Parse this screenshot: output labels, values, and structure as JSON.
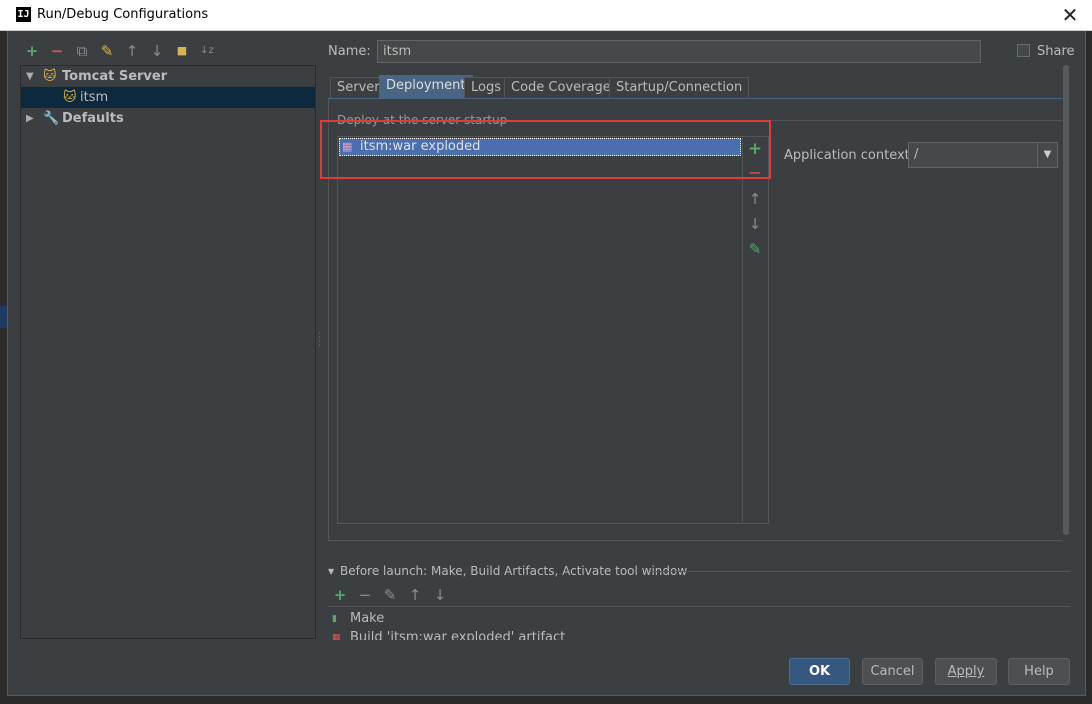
{
  "window": {
    "title": "Run/Debug Configurations",
    "app_icon": "IJ",
    "close_glyph": "✕"
  },
  "toolbar": {
    "add": "+",
    "remove": "−",
    "copy": "⧉",
    "edit_defaults": "✎",
    "move_up": "↑",
    "move_down": "↓",
    "folder": "■",
    "sort": "↓z"
  },
  "tree": {
    "items": [
      {
        "label": "Tomcat Server",
        "expanded": true,
        "icon": "tomcat-icon"
      },
      {
        "label": "itsm",
        "selected": true,
        "icon": "tomcat-icon"
      },
      {
        "label": "Defaults",
        "expanded": false,
        "icon": "wrench-icon"
      }
    ]
  },
  "name_field": {
    "label": "Name:",
    "value": "itsm"
  },
  "share": {
    "label": "Share",
    "checked": false
  },
  "tabs": [
    {
      "label": "Server"
    },
    {
      "label": "Deployment",
      "active": true
    },
    {
      "label": "Logs"
    },
    {
      "label": "Code Coverage"
    },
    {
      "label": "Startup/Connection"
    }
  ],
  "deployment": {
    "group_title": "Deploy at the server startup",
    "items": [
      {
        "label": "itsm:war exploded"
      }
    ],
    "side_buttons": {
      "add": "+",
      "remove": "−",
      "up": "↑",
      "down": "↓",
      "edit": "✎"
    },
    "context_label": "Application context:",
    "context_value": "/",
    "context_dropdown": "▼"
  },
  "before_launch": {
    "title": "Before launch: Make, Build Artifacts, Activate tool window",
    "toolbar": {
      "add": "+",
      "remove": "−",
      "edit": "✎",
      "up": "↑",
      "down": "↓"
    },
    "items": [
      {
        "label": "Make"
      },
      {
        "label": "Build 'itsm:war exploded' artifact"
      }
    ]
  },
  "buttons": {
    "ok": "OK",
    "cancel": "Cancel",
    "apply": "Apply",
    "help": "Help"
  },
  "colors": {
    "background": "#3c3f41",
    "selection": "#4b6eaf",
    "tab_active": "#4a6584",
    "highlight": "#e03b3b",
    "add_green": "#59a869",
    "remove_red": "#e05555"
  }
}
